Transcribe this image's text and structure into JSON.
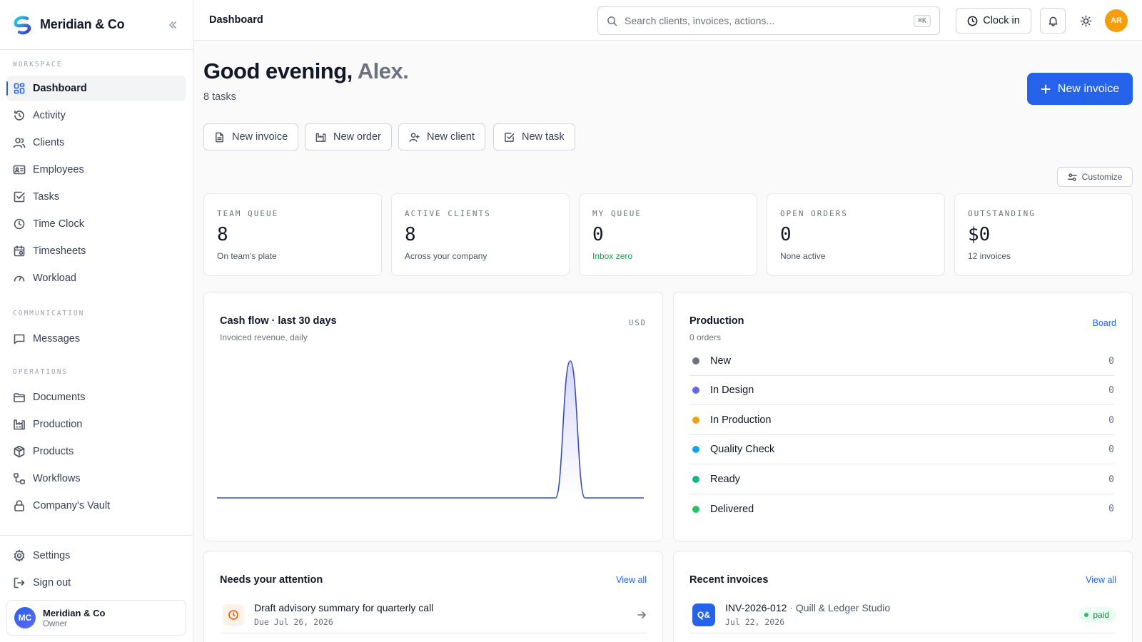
{
  "brand": {
    "name": "Meridian & Co"
  },
  "sidebar": {
    "sections": [
      {
        "label": "WORKSPACE",
        "items": [
          {
            "label": "Dashboard",
            "icon": "grid-icon",
            "active": true
          },
          {
            "label": "Activity",
            "icon": "history-icon"
          },
          {
            "label": "Clients",
            "icon": "users-icon"
          },
          {
            "label": "Employees",
            "icon": "id-card-icon"
          },
          {
            "label": "Tasks",
            "icon": "check-square-icon"
          },
          {
            "label": "Time Clock",
            "icon": "clock-icon"
          },
          {
            "label": "Timesheets",
            "icon": "calendar-icon"
          },
          {
            "label": "Workload",
            "icon": "gauge-icon"
          }
        ]
      },
      {
        "label": "COMMUNICATION",
        "items": [
          {
            "label": "Messages",
            "icon": "message-icon"
          }
        ]
      },
      {
        "label": "OPERATIONS",
        "items": [
          {
            "label": "Documents",
            "icon": "folder-icon"
          },
          {
            "label": "Production",
            "icon": "factory-icon"
          },
          {
            "label": "Products",
            "icon": "box-icon"
          },
          {
            "label": "Workflows",
            "icon": "workflow-icon"
          },
          {
            "label": "Company's Vault",
            "icon": "lock-icon"
          }
        ]
      }
    ],
    "bottom": [
      {
        "label": "Settings",
        "icon": "gear-icon"
      },
      {
        "label": "Sign out",
        "icon": "sign-out-icon"
      }
    ],
    "account": {
      "initials": "MC",
      "name": "Meridian & Co",
      "role": "Owner"
    }
  },
  "topbar": {
    "title": "Dashboard",
    "search_placeholder": "Search clients, invoices, actions...",
    "search_shortcut": "⌘K",
    "clock_in_label": "Clock in",
    "user_initials": "AR"
  },
  "main": {
    "greeting_prefix": "Good evening,",
    "greeting_name": "Alex.",
    "tasks_count": "8 tasks",
    "primary_action": "New invoice",
    "quick_actions": [
      {
        "label": "New invoice",
        "icon": "document-icon"
      },
      {
        "label": "New order",
        "icon": "factory-icon"
      },
      {
        "label": "New client",
        "icon": "user-plus-icon"
      },
      {
        "label": "New task",
        "icon": "check-square-icon"
      }
    ],
    "customize_label": "Customize",
    "stats": [
      {
        "label": "TEAM QUEUE",
        "value": "8",
        "sub": "On team's plate"
      },
      {
        "label": "ACTIVE CLIENTS",
        "value": "8",
        "sub": "Across your company"
      },
      {
        "label": "MY QUEUE",
        "value": "0",
        "sub": "Inbox zero",
        "good": true
      },
      {
        "label": "OPEN ORDERS",
        "value": "0",
        "sub": "None active"
      },
      {
        "label": "OUTSTANDING",
        "value": "$0",
        "sub": "12 invoices"
      }
    ],
    "cashflow": {
      "title": "Cash flow · last 30 days",
      "subtitle": "Invoiced revenue, daily",
      "currency": "USD",
      "line_color": "#3b4cc0"
    },
    "production": {
      "title": "Production",
      "subtitle": "0 orders",
      "link": "Board",
      "stages": [
        {
          "name": "New",
          "count": "0",
          "color": "#6b7280"
        },
        {
          "name": "In Design",
          "count": "0",
          "color": "#6366f1"
        },
        {
          "name": "In Production",
          "count": "0",
          "color": "#f59e0b"
        },
        {
          "name": "Quality Check",
          "count": "0",
          "color": "#0ea5e9"
        },
        {
          "name": "Ready",
          "count": "0",
          "color": "#10b981"
        },
        {
          "name": "Delivered",
          "count": "0",
          "color": "#22c55e"
        }
      ]
    },
    "attention": {
      "title": "Needs your attention",
      "link": "View all",
      "items": [
        {
          "title": "Draft advisory summary for quarterly call",
          "due": "Due Jul 26, 2026"
        }
      ]
    },
    "invoices": {
      "title": "Recent invoices",
      "link": "View all",
      "items": [
        {
          "badge": "Q&",
          "number": "INV-2026-012",
          "client": "Quill & Ledger Studio",
          "date": "Jul 22, 2026",
          "status": "paid"
        }
      ]
    }
  },
  "chart_data": {
    "type": "line",
    "x": [
      1,
      2,
      3,
      4,
      5,
      6,
      7,
      8,
      9,
      10,
      11,
      12,
      13,
      14,
      15,
      16,
      17,
      18,
      19,
      20,
      21,
      22,
      23,
      24,
      25,
      26,
      27,
      28,
      29,
      30
    ],
    "series": [
      {
        "values": [
          0,
          0,
          0,
          0,
          0,
          0,
          0,
          0,
          0,
          0,
          0,
          0,
          0,
          0,
          0,
          0,
          0,
          0,
          0,
          0,
          0,
          0,
          0,
          0,
          1,
          0,
          0,
          0,
          0,
          0
        ]
      }
    ],
    "title": "Cash flow · last 30 days",
    "subtitle": "Invoiced revenue, daily",
    "unit": "USD",
    "grid": false,
    "legend": "none"
  }
}
